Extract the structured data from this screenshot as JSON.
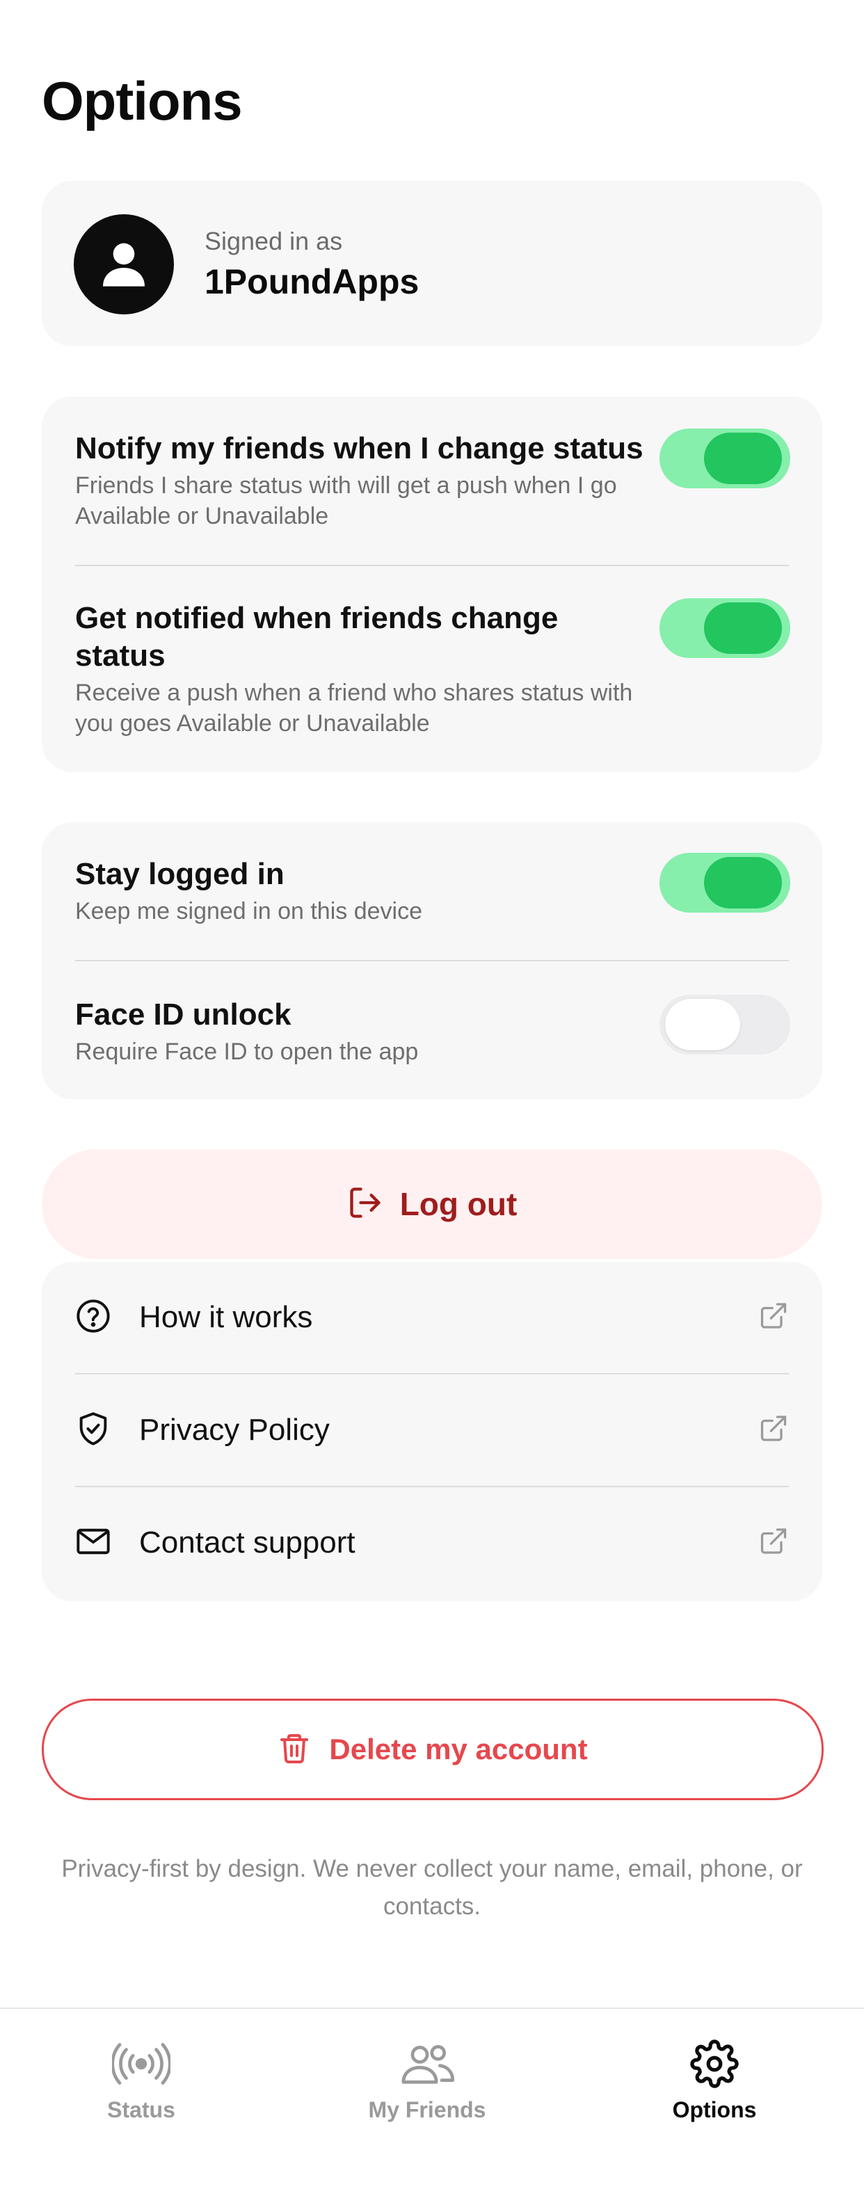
{
  "page": {
    "title": "Options"
  },
  "profile": {
    "signed_in_label": "Signed in as",
    "username": "1PoundApps",
    "avatar_icon": "user-icon"
  },
  "notifications": {
    "notify_friends": {
      "title": "Notify my friends when I change status",
      "description": "Friends I share status with will get a push when I go Available or Unavailable",
      "enabled": true
    },
    "get_notified": {
      "title": "Get notified when friends change status",
      "description": "Receive a push when a friend who shares status with you goes Available or Unavailable",
      "enabled": true
    }
  },
  "security": {
    "stay_logged_in": {
      "title": "Stay logged in",
      "description": "Keep me signed in on this device",
      "enabled": true
    },
    "face_id": {
      "title": "Face ID unlock",
      "description": "Require Face ID to open the app",
      "enabled": false
    }
  },
  "logout": {
    "label": "Log out",
    "icon": "logout-icon"
  },
  "links": [
    {
      "label": "How it works",
      "icon": "question-circle-icon"
    },
    {
      "label": "Privacy Policy",
      "icon": "shield-check-icon"
    },
    {
      "label": "Contact support",
      "icon": "envelope-icon"
    }
  ],
  "delete_account": {
    "label": "Delete my account",
    "icon": "trash-icon"
  },
  "footer": {
    "note": "Privacy-first by design. We never collect your name, email, phone, or contacts."
  },
  "tabbar": {
    "tabs": [
      {
        "label": "Status",
        "icon": "broadcast-icon",
        "active": false
      },
      {
        "label": "My Friends",
        "icon": "users-icon",
        "active": false
      },
      {
        "label": "Options",
        "icon": "gear-icon",
        "active": true
      }
    ]
  },
  "colors": {
    "toggle_on_track": "#86efac",
    "toggle_on_knob": "#22c55e",
    "logout_bg": "#fff1f1",
    "logout_text": "#9f1d1d",
    "danger": "#e5484d",
    "card_bg": "#f7f7f8"
  }
}
